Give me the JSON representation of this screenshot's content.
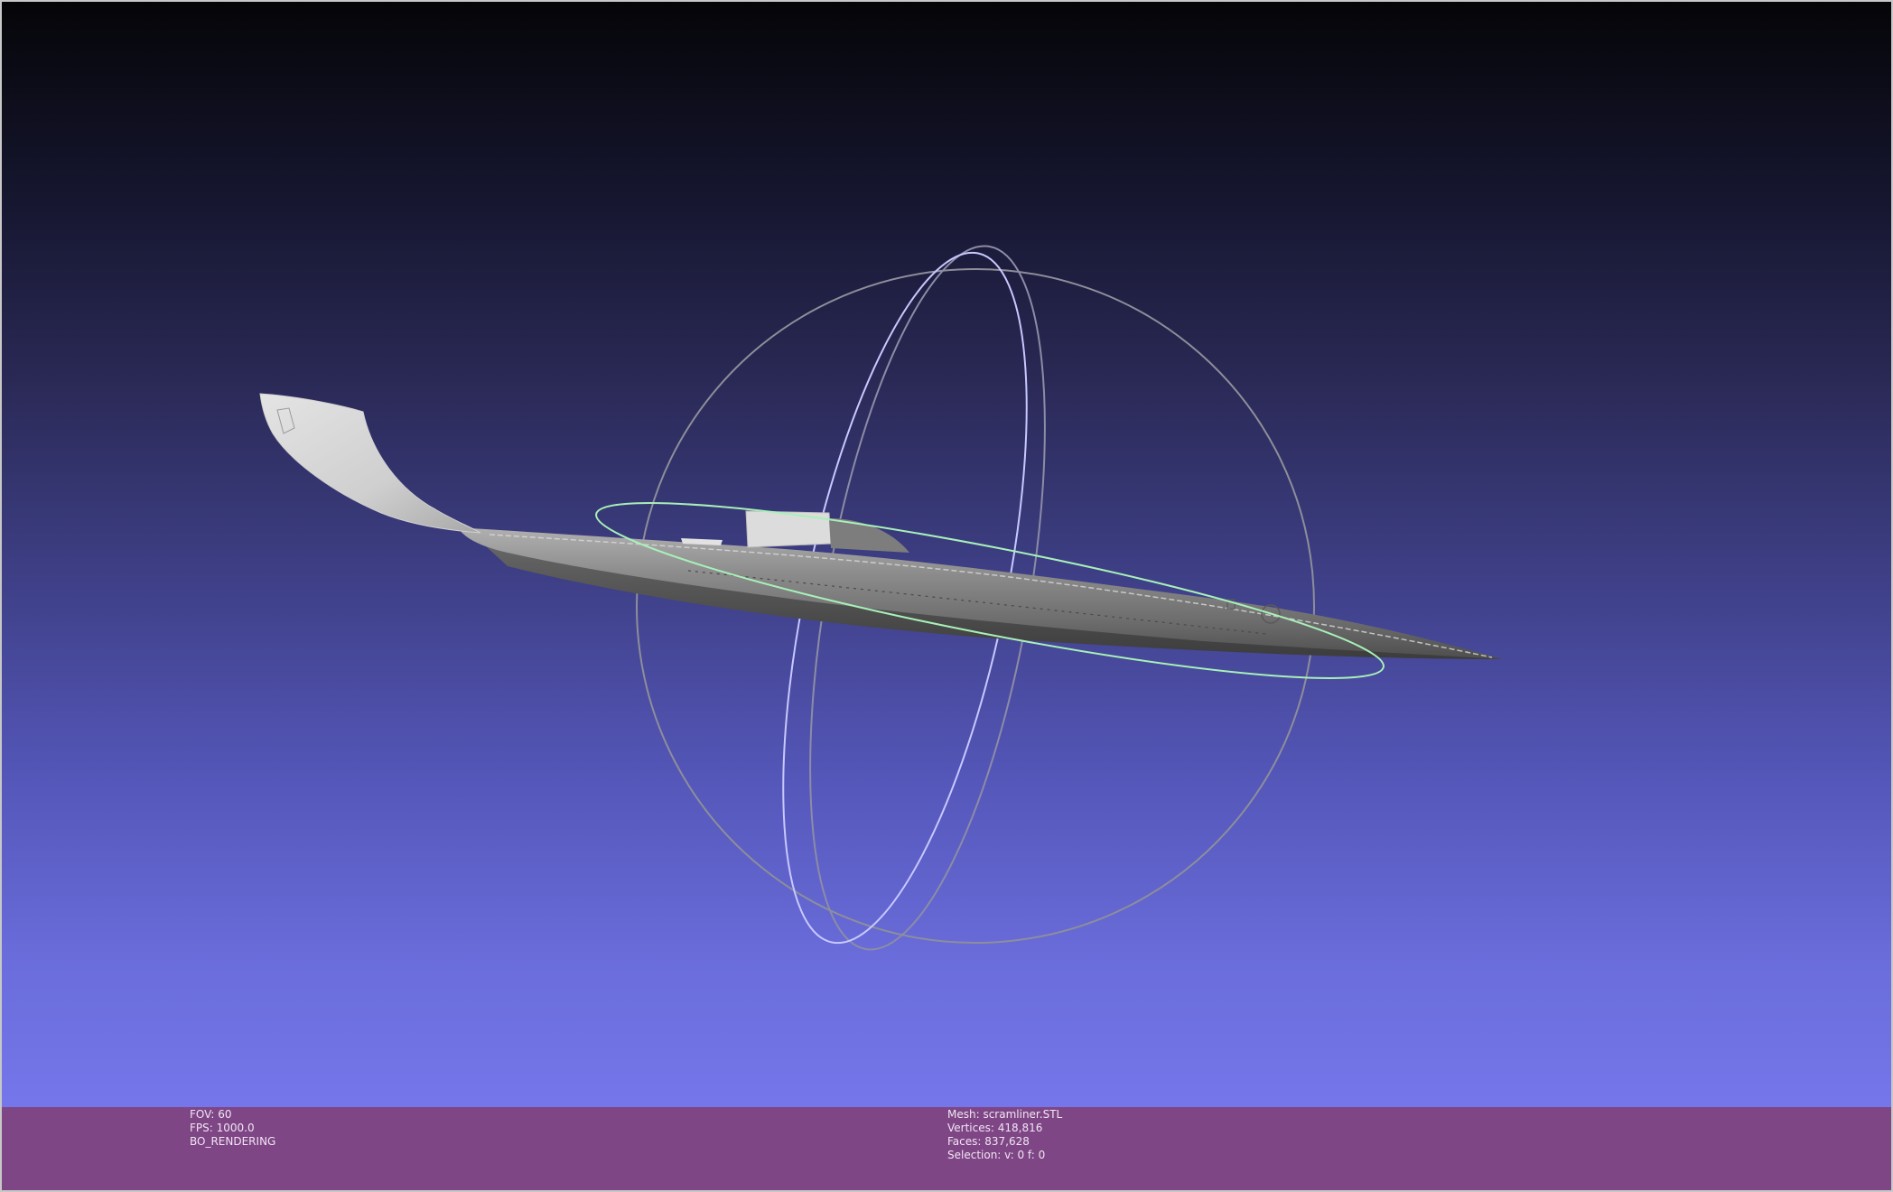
{
  "viewport": {
    "background_top": "#050508",
    "background_bottom": "#7576ea",
    "trackball": {
      "ring_colors": [
        "#8e8e9a",
        "#c8c8ff",
        "#a8f0b8"
      ]
    },
    "mesh_color": "#8a8a8a"
  },
  "info_left": {
    "fov": "FOV: 60",
    "fps": "FPS:  1000.0",
    "mode": "BO_RENDERING"
  },
  "info_right": {
    "mesh": "Mesh: scramliner.STL",
    "vertices": "Vertices: 418,816",
    "faces": "Faces: 837,628",
    "selection": "Selection: v: 0 f: 0"
  },
  "infobar": {
    "background": "#7f4686",
    "text_color": "#f0e6f2"
  }
}
